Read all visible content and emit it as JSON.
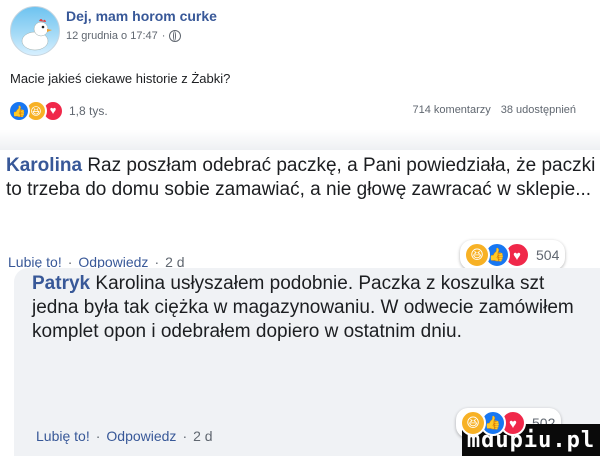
{
  "post": {
    "page_name": "Dej, mam horom curke",
    "timestamp": "12 grudnia o 17:47",
    "privacy_icon": "globe-icon",
    "text": "Macie jakieś ciekawe historie z Żabki?",
    "reactions": [
      "like",
      "haha",
      "love"
    ],
    "reaction_count": "1,8 tys.",
    "comments_count": "714 komentarzy",
    "shares_count": "38 udostępnień"
  },
  "comment1": {
    "author": "Karolina",
    "text": "Raz poszłam odebrać paczkę, a Pani powiedziała, że paczki to trzeba do domu sobie zamawiać, a nie głowę zawracać w sklepie...",
    "like_label": "Lubię to!",
    "sep1": "·",
    "reply_label": "Odpowiedz",
    "sep2": "·",
    "age": "2 d",
    "reaction_count": "504"
  },
  "comment2": {
    "author": "Patryk",
    "text": "Karolina usłyszałem podobnie. Paczka z koszulka szt jedna była tak ciężka w magazynowaniu. W odwecie zamówiłem komplet opon i odebrałem dopiero w ostatnim dniu.",
    "like_label": "Lubię to!",
    "sep1": "·",
    "reply_label": "Odpowiedz",
    "sep2": "·",
    "age": "2 d",
    "reaction_count": "502"
  },
  "watermark": "mdupiu.pl",
  "colors": {
    "link": "#385898",
    "like": "#1877f2",
    "haha": "#f7b125",
    "love": "#f0284a",
    "bubble": "#f0f2f5"
  }
}
